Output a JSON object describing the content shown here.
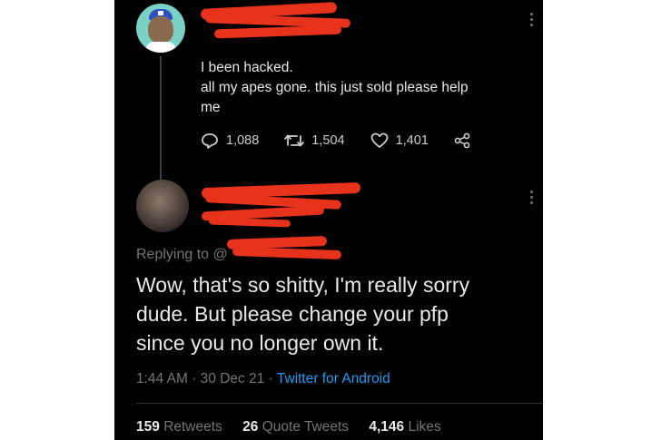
{
  "original_tweet": {
    "text_lines": [
      "I been hacked.",
      "all my apes gone. this just sold please help",
      "me"
    ],
    "actions": {
      "replies": "1,088",
      "retweets": "1,504",
      "likes": "1,401"
    }
  },
  "reply_tweet": {
    "replying_to_label": "Replying to @",
    "text_lines": [
      "Wow, that's so shitty, I'm really sorry",
      "dude. But please change your pfp",
      "since you no longer own it."
    ],
    "time": "1:44 AM",
    "date": "30 Dec 21",
    "source": "Twitter for Android",
    "sep": "·",
    "stats": {
      "retweets_count": "159",
      "retweets_label": "Retweets",
      "quotes_count": "26",
      "quotes_label": "Quote Tweets",
      "likes_count": "4,146",
      "likes_label": "Likes"
    }
  },
  "colors": {
    "background": "#000000",
    "text": "#e7e9ea",
    "muted": "#71767b",
    "link": "#1d9bf0",
    "redaction": "#e8331c"
  },
  "icons": [
    "reply-icon",
    "retweet-icon",
    "like-icon",
    "share-icon",
    "more-icon"
  ]
}
